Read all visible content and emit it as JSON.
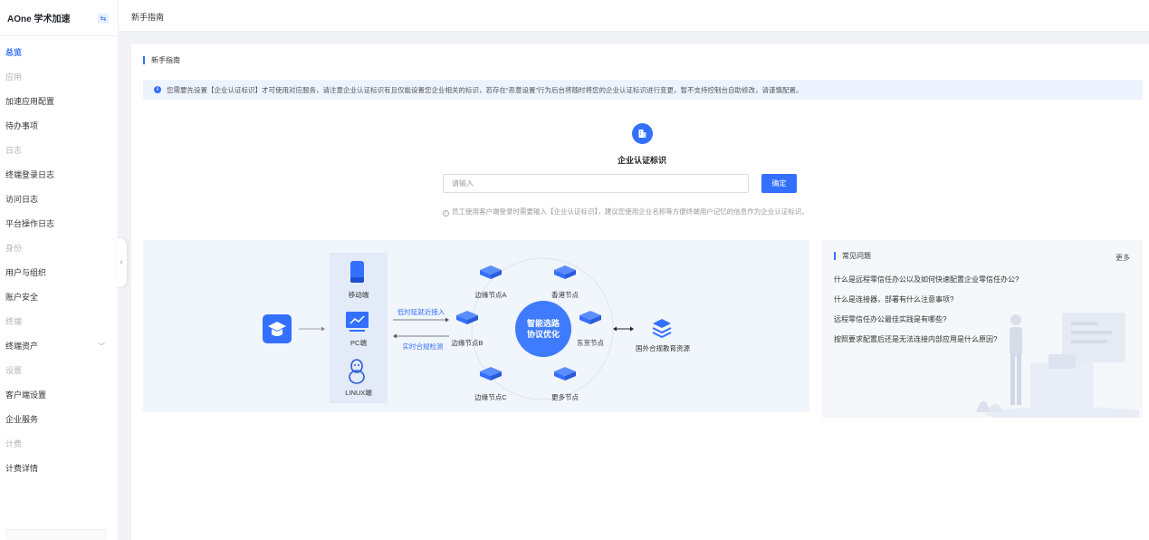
{
  "sidebar": {
    "title": "AOne 学术加速",
    "toggle_icon": "swap-icon",
    "items": [
      {
        "label": "总览",
        "type": "item",
        "active": true
      },
      {
        "label": "应用",
        "type": "group"
      },
      {
        "label": "加速应用配置",
        "type": "item"
      },
      {
        "label": "待办事项",
        "type": "item"
      },
      {
        "label": "日志",
        "type": "group"
      },
      {
        "label": "终端登录日志",
        "type": "item"
      },
      {
        "label": "访问日志",
        "type": "item"
      },
      {
        "label": "平台操作日志",
        "type": "item"
      },
      {
        "label": "身份",
        "type": "group"
      },
      {
        "label": "用户与组织",
        "type": "item"
      },
      {
        "label": "账户安全",
        "type": "item"
      },
      {
        "label": "终端",
        "type": "group"
      },
      {
        "label": "终端资产",
        "type": "item",
        "chevron": "﹀"
      },
      {
        "label": "设置",
        "type": "group"
      },
      {
        "label": "客户端设置",
        "type": "item"
      },
      {
        "label": "企业服务",
        "type": "item"
      },
      {
        "label": "计费",
        "type": "group"
      },
      {
        "label": "计费详情",
        "type": "item"
      }
    ]
  },
  "header": {
    "title": "新手指南"
  },
  "main": {
    "section_title": "新手指南",
    "alert": "您需要先设置【企业认证标识】才可使用对应服务，请注意企业认证标识有且仅能设置您企业相关的标识，若存在“恶意设置”行为后台将随时将您的企业认证标识进行变更，暂不支持控制台自助修改，请谨慎配置。",
    "identity": {
      "title": "企业认证标识",
      "placeholder": "请输入",
      "value": "",
      "confirm_label": "确定",
      "hint": "员工使用客户端登录时需要输入【企业认证标识】，建议您使用企业名称等方便终端用户记忆的信息作为企业认证标识。"
    }
  },
  "diagram": {
    "clients": [
      "移动端",
      "PC端",
      "LINUX端"
    ],
    "arrow_top": "低时延就近接入",
    "arrow_bottom": "实时合规检测",
    "nodes": [
      "边缘节点A",
      "香港节点",
      "边缘节点B",
      "东京节点",
      "边缘节点C",
      "更多节点"
    ],
    "center": [
      "智能选路",
      "协议优化"
    ],
    "destination": "国外合规教育资源"
  },
  "faq": {
    "title": "常见问题",
    "more": "更多",
    "items": [
      "什么是远程零信任办公以及如何快速配置企业零信任办公?",
      "什么是连接器，部署有什么注意事项?",
      "远程零信任办公最佳实践是有哪些?",
      "按照要求配置后还是无法连接内部应用是什么原因?"
    ]
  },
  "colors": {
    "accent": "#3370ff",
    "alert_bg": "#eef4ff",
    "diagram_bg": "#f1f5fc"
  }
}
